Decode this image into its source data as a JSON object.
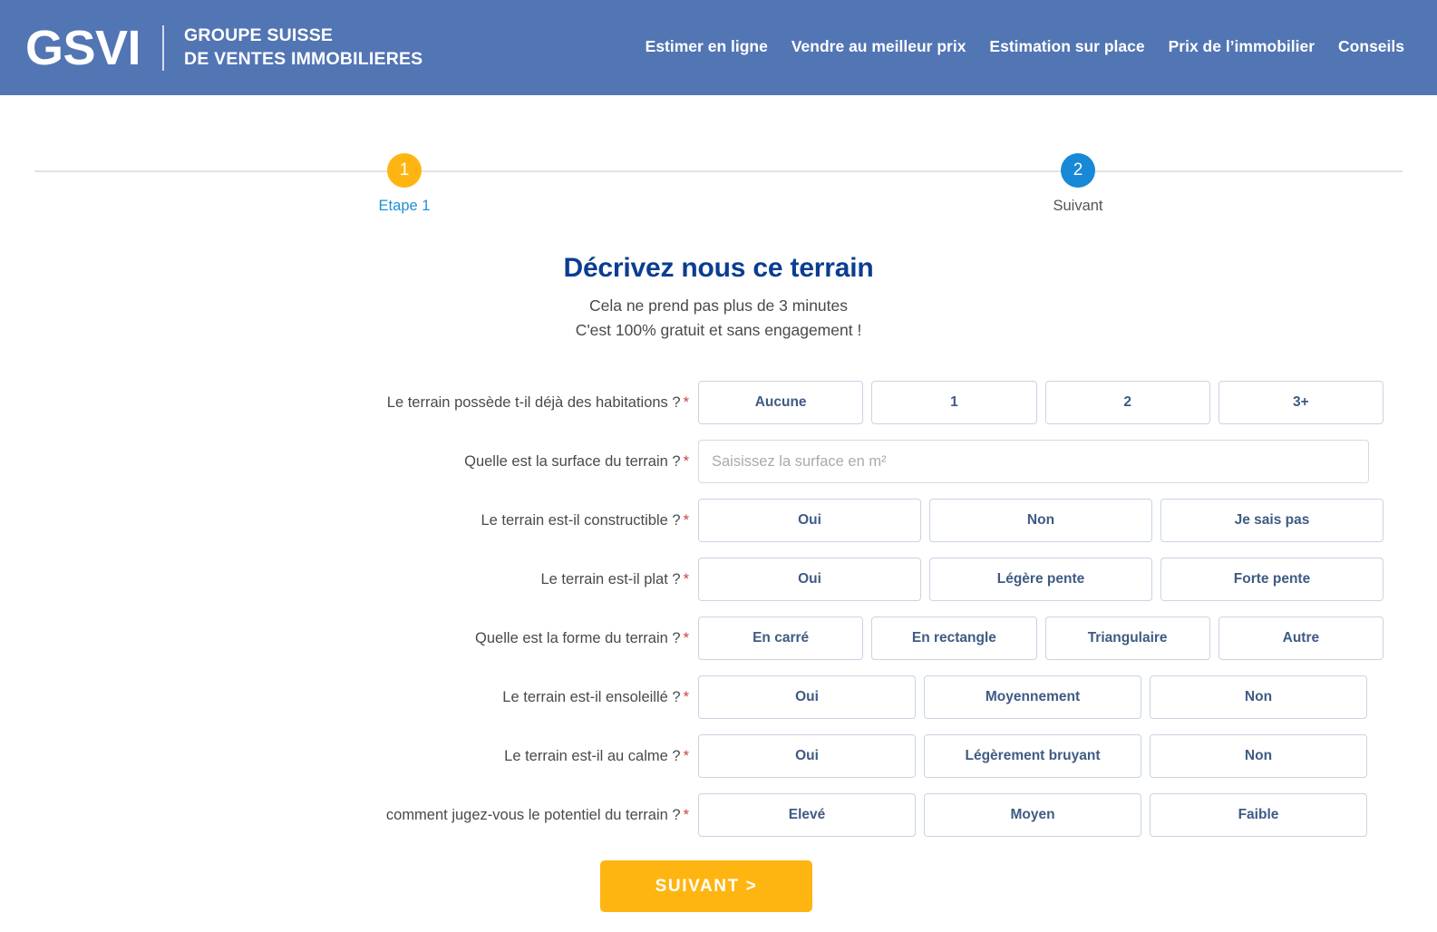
{
  "header": {
    "brand_mark": "GSVI",
    "brand_sub_line1": "GROUPE SUISSE",
    "brand_sub_line2": "DE VENTES IMMOBILIERES",
    "background_color": "#5275b4",
    "nav": [
      {
        "label": "Estimer en ligne"
      },
      {
        "label": "Vendre au meilleur prix"
      },
      {
        "label": "Estimation sur place"
      },
      {
        "label": "Prix de l’immobilier"
      },
      {
        "label": "Conseils"
      }
    ]
  },
  "stepper": {
    "steps": [
      {
        "number": "1",
        "label": "Etape 1",
        "circle_color": "#ffb511",
        "label_color": "#1e90d8",
        "state": "current"
      },
      {
        "number": "2",
        "label": "Suivant",
        "circle_color": "#1789d6",
        "label_color": "#555555",
        "state": "upcoming"
      }
    ]
  },
  "intro": {
    "title": "Décrivez nous ce terrain",
    "title_color": "#0b3d91",
    "subtitle_line1": "Cela ne prend pas plus de 3 minutes",
    "subtitle_line2": "C'est 100% gratuit et sans engagement !"
  },
  "form": {
    "required_marker": "*",
    "rows": [
      {
        "id": "habitations",
        "label": "Le terrain possède t-il déjà des habitations ?",
        "type": "choices",
        "columns": 4,
        "options": [
          "Aucune",
          "1",
          "2",
          "3+"
        ]
      },
      {
        "id": "surface",
        "label": "Quelle est la surface du terrain ?",
        "type": "text",
        "placeholder": "Saisissez la surface en m²",
        "value": ""
      },
      {
        "id": "constructible",
        "label": "Le terrain est-il constructible ?",
        "type": "choices",
        "columns": 3,
        "options": [
          "Oui",
          "Non",
          "Je sais pas"
        ]
      },
      {
        "id": "plat",
        "label": "Le terrain est-il plat ?",
        "type": "choices",
        "columns": 3,
        "options": [
          "Oui",
          "Légère pente",
          "Forte pente"
        ]
      },
      {
        "id": "forme",
        "label": "Quelle est la forme du terrain ?",
        "type": "choices",
        "columns": 4,
        "options": [
          "En carré",
          "En rectangle",
          "Triangulaire",
          "Autre"
        ]
      },
      {
        "id": "ensoleille",
        "label": "Le terrain est-il ensoleillé ?",
        "type": "choices",
        "columns": 3,
        "options": [
          "Oui",
          "Moyennement",
          "Non"
        ]
      },
      {
        "id": "calme",
        "label": "Le terrain est-il au calme ?",
        "type": "choices",
        "columns": 3,
        "options": [
          "Oui",
          "Légèrement bruyant",
          "Non"
        ]
      },
      {
        "id": "potentiel",
        "label": "comment jugez-vous le potentiel du terrain ?",
        "type": "choices",
        "columns": 3,
        "options": [
          "Elevé",
          "Moyen",
          "Faible"
        ]
      }
    ],
    "submit": {
      "label": "SUIVANT  >",
      "background_color": "#ffb511",
      "text_color": "#ffffff"
    }
  }
}
